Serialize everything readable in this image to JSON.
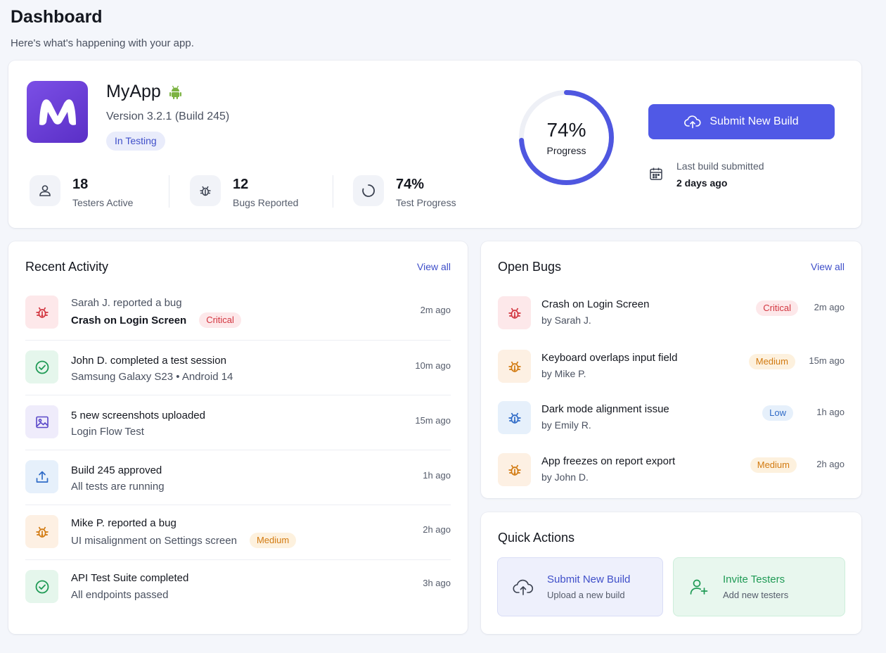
{
  "header": {
    "title": "Dashboard",
    "subtitle": "Here's what's happening with your app."
  },
  "app": {
    "logo_letter": "M",
    "name": "MyApp",
    "platform_icon": "android-icon",
    "version": "Version 3.2.1 (Build 245)",
    "status": "In Testing",
    "stats": [
      {
        "icon": "user-icon",
        "value": "18",
        "label": "Testers Active"
      },
      {
        "icon": "bug-icon",
        "value": "12",
        "label": "Bugs Reported"
      },
      {
        "icon": "progress-icon",
        "value": "74%",
        "label": "Test Progress"
      }
    ],
    "progress": {
      "value_text": "74%",
      "label": "Progress",
      "fraction": 0.74
    },
    "submit_label": "Submit New Build",
    "last_build_label": "Last build submitted",
    "last_build_value": "2 days ago"
  },
  "activity": {
    "title": "Recent Activity",
    "view_all": "View all",
    "items": [
      {
        "icon": "bug-icon",
        "tone": "red",
        "line1": "Sarah J. reported a bug",
        "line2": "Crash on Login Screen",
        "badge": "Critical",
        "badge_type": "critical",
        "time": "2m ago"
      },
      {
        "icon": "check-circle-icon",
        "tone": "green",
        "line1": "John D. completed a test session",
        "line2": "Samsung Galaxy S23 • Android 14",
        "time": "10m ago"
      },
      {
        "icon": "image-icon",
        "tone": "purple",
        "line1": "5 new screenshots uploaded",
        "line2": "Login Flow Test",
        "time": "15m ago"
      },
      {
        "icon": "upload-icon",
        "tone": "blue",
        "line1": "Build 245 approved",
        "line2": "All tests are running",
        "time": "1h ago"
      },
      {
        "icon": "bug-icon",
        "tone": "orange",
        "line1": "Mike P. reported a bug",
        "line2": "UI misalignment on Settings screen",
        "badge": "Medium",
        "badge_type": "medium",
        "time": "2h ago"
      },
      {
        "icon": "check-circle-icon",
        "tone": "green",
        "line1": "API Test Suite completed",
        "line2": "All endpoints passed",
        "time": "3h ago"
      }
    ]
  },
  "bugs": {
    "title": "Open Bugs",
    "view_all": "View all",
    "items": [
      {
        "tone": "red",
        "title": "Crash on Login Screen",
        "by": "by Sarah J.",
        "badge": "Critical",
        "badge_type": "critical",
        "time": "2m ago"
      },
      {
        "tone": "orange",
        "title": "Keyboard overlaps input field",
        "by": "by Mike P.",
        "badge": "Medium",
        "badge_type": "medium",
        "time": "15m ago"
      },
      {
        "tone": "blue",
        "title": "Dark mode alignment issue",
        "by": "by Emily R.",
        "badge": "Low",
        "badge_type": "low",
        "time": "1h ago"
      },
      {
        "tone": "orange",
        "title": "App freezes on report export",
        "by": "by John D.",
        "badge": "Medium",
        "badge_type": "medium",
        "time": "2h ago"
      }
    ]
  },
  "quick_actions": {
    "title": "Quick Actions",
    "items": [
      {
        "icon": "cloud-upload-icon",
        "title": "Submit New Build",
        "subtitle": "Upload a new build"
      },
      {
        "icon": "add-user-icon",
        "title": "Invite Testers",
        "subtitle": "Add new testers"
      }
    ]
  },
  "colors": {
    "accent": "#5059e6",
    "critical": "#d2353f",
    "medium": "#d27a10",
    "low": "#2f6bc7",
    "success": "#1f9a55",
    "android": "#7cb342"
  }
}
